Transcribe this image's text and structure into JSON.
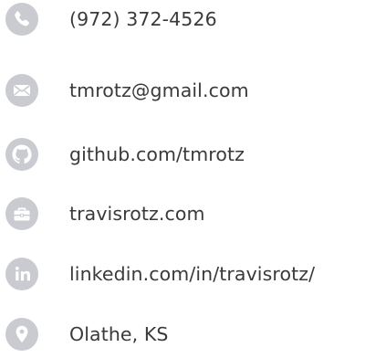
{
  "colors": {
    "icon_circle": "#c9cbd0",
    "icon_glyph": "#ffffff",
    "text": "#3a3a3a"
  },
  "contacts": [
    {
      "icon": "phone-icon",
      "label": "(972) 372-4526"
    },
    {
      "icon": "envelope-icon",
      "label": "tmrotz@gmail.com"
    },
    {
      "icon": "github-icon",
      "label": "github.com/tmrotz"
    },
    {
      "icon": "briefcase-icon",
      "label": "travisrotz.com"
    },
    {
      "icon": "linkedin-icon",
      "label": "linkedin.com/in/travisrotz/"
    },
    {
      "icon": "map-pin-icon",
      "label": "Olathe, KS"
    }
  ]
}
